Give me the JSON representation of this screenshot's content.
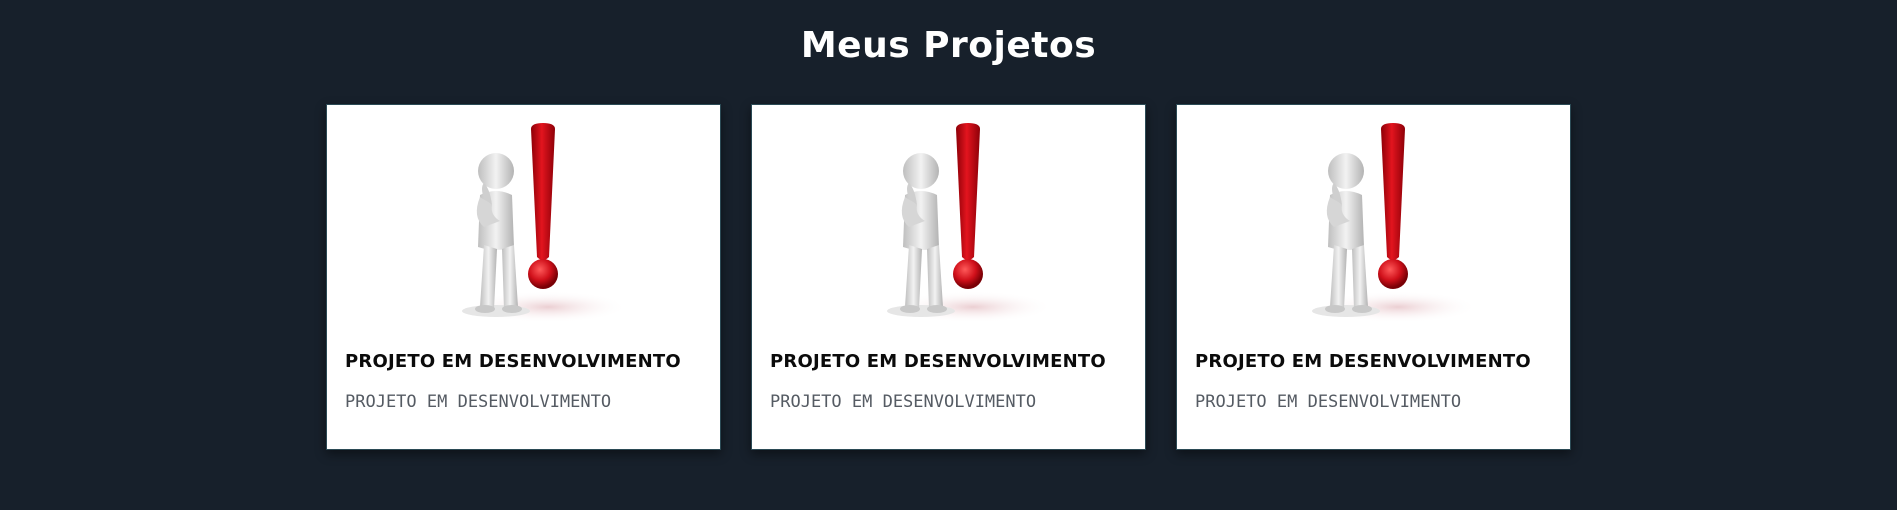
{
  "section": {
    "title": "Meus Projetos"
  },
  "projects": [
    {
      "image_icon": "thinking-figure-exclamation-icon",
      "title": "PROJETO EM DESENVOLVIMENTO",
      "description": "PROJETO EM DESENVOLVIMENTO"
    },
    {
      "image_icon": "thinking-figure-exclamation-icon",
      "title": "PROJETO EM DESENVOLVIMENTO",
      "description": "PROJETO EM DESENVOLVIMENTO"
    },
    {
      "image_icon": "thinking-figure-exclamation-icon",
      "title": "PROJETO EM DESENVOLVIMENTO",
      "description": "PROJETO EM DESENVOLVIMENTO"
    }
  ],
  "colors": {
    "background": "#17202b",
    "card_background": "#ffffff",
    "title_text": "#ffffff",
    "card_title_text": "#0b0b0b",
    "card_desc_text": "#555b63",
    "exclamation_red": "#d0101a"
  }
}
